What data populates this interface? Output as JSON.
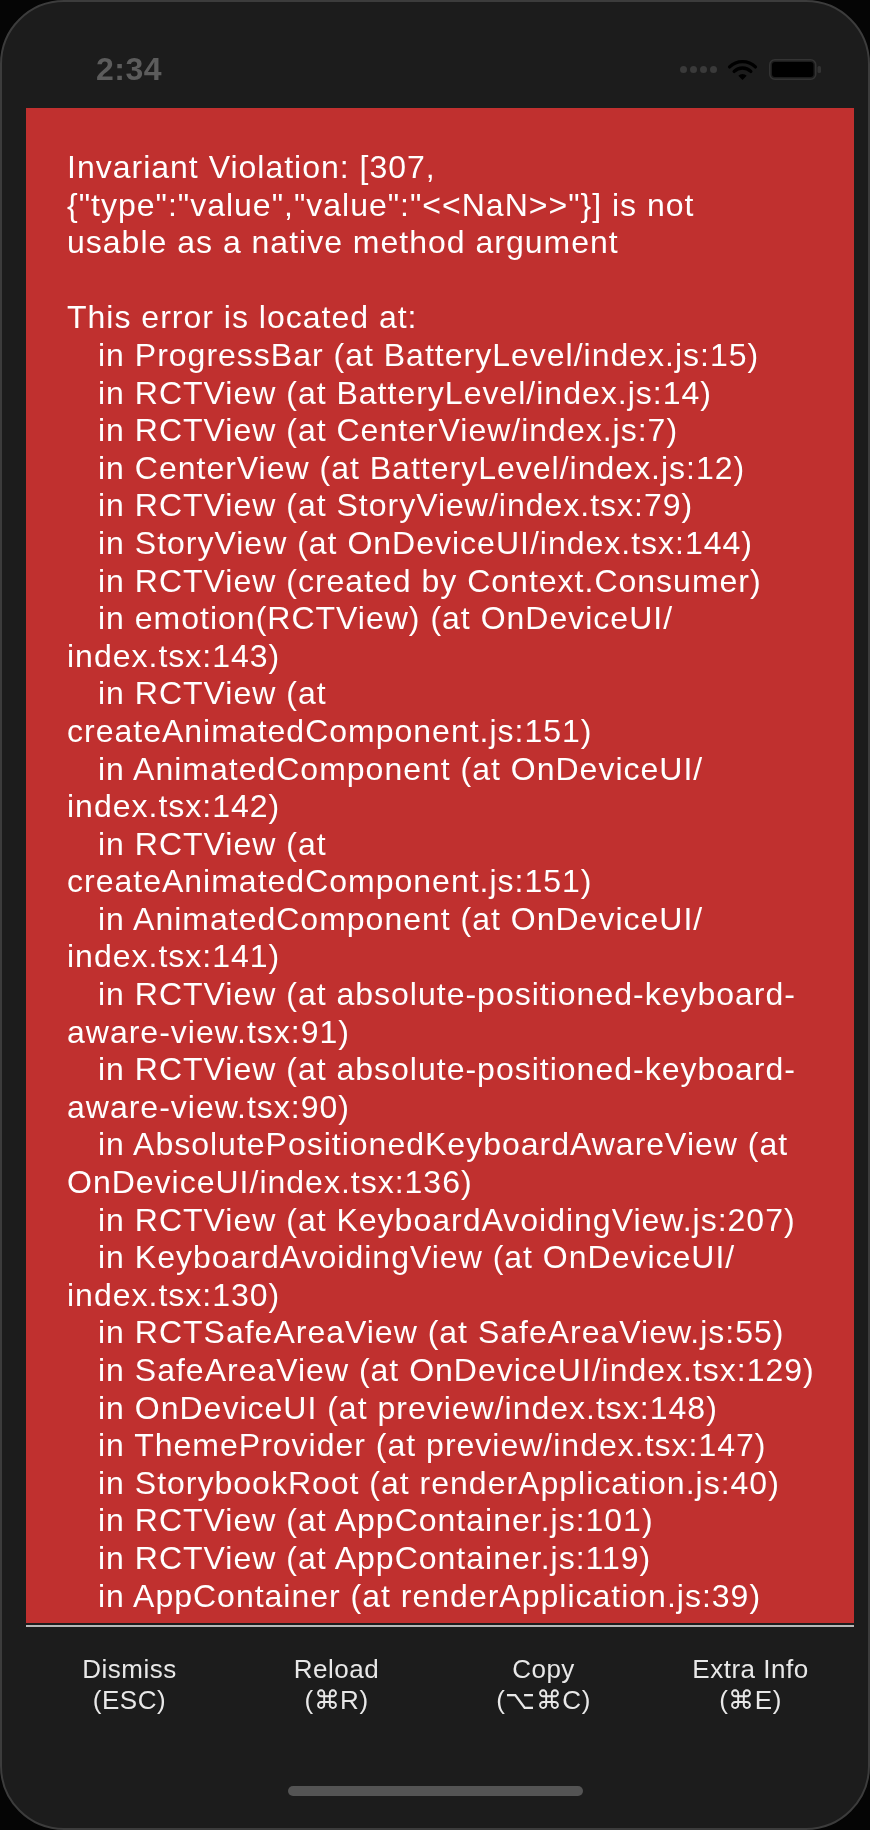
{
  "status_bar": {
    "time": "2:34"
  },
  "error": {
    "message_lines": [
      "Invariant Violation: [307,",
      "{\"type\":\"value\",\"value\":\"<<NaN>>\"}] is not",
      "usable as a native method argument"
    ],
    "location_heading": "This error is located at:",
    "stack": [
      {
        "lines": [
          "in ProgressBar (at BatteryLevel/index.js:15)"
        ]
      },
      {
        "lines": [
          "in RCTView (at BatteryLevel/index.js:14)"
        ]
      },
      {
        "lines": [
          "in RCTView (at CenterView/index.js:7)"
        ]
      },
      {
        "lines": [
          "in CenterView (at BatteryLevel/index.js:12)"
        ]
      },
      {
        "lines": [
          "in RCTView (at StoryView/index.tsx:79)"
        ]
      },
      {
        "lines": [
          "in StoryView (at OnDeviceUI/index.tsx:144)"
        ]
      },
      {
        "lines": [
          "in RCTView (created by Context.Consumer)"
        ]
      },
      {
        "lines": [
          "in emotion(RCTView) (at OnDeviceUI/",
          "index.tsx:143)"
        ]
      },
      {
        "lines": [
          "in RCTView (at",
          "createAnimatedComponent.js:151)"
        ]
      },
      {
        "lines": [
          "in AnimatedComponent (at OnDeviceUI/",
          "index.tsx:142)"
        ]
      },
      {
        "lines": [
          "in RCTView (at",
          "createAnimatedComponent.js:151)"
        ]
      },
      {
        "lines": [
          "in AnimatedComponent (at OnDeviceUI/",
          "index.tsx:141)"
        ]
      },
      {
        "lines": [
          "in RCTView (at absolute-positioned-keyboard-",
          "aware-view.tsx:91)"
        ]
      },
      {
        "lines": [
          "in RCTView (at absolute-positioned-keyboard-",
          "aware-view.tsx:90)"
        ]
      },
      {
        "lines": [
          "in AbsolutePositionedKeyboardAwareView (at",
          "OnDeviceUI/index.tsx:136)"
        ]
      },
      {
        "lines": [
          "in RCTView (at KeyboardAvoidingView.js:207)"
        ]
      },
      {
        "lines": [
          "in KeyboardAvoidingView (at OnDeviceUI/",
          "index.tsx:130)"
        ]
      },
      {
        "lines": [
          "in RCTSafeAreaView (at SafeAreaView.js:55)"
        ]
      },
      {
        "lines": [
          "in SafeAreaView (at OnDeviceUI/index.tsx:129)"
        ]
      },
      {
        "lines": [
          "in OnDeviceUI (at preview/index.tsx:148)"
        ]
      },
      {
        "lines": [
          "in ThemeProvider (at preview/index.tsx:147)"
        ]
      },
      {
        "lines": [
          "in StorybookRoot (at renderApplication.js:40)"
        ]
      },
      {
        "lines": [
          "in RCTView (at AppContainer.js:101)"
        ]
      },
      {
        "lines": [
          "in RCTView (at AppContainer.js:119)"
        ]
      },
      {
        "lines": [
          "in AppContainer (at renderApplication.js:39)"
        ]
      }
    ]
  },
  "actions": [
    {
      "label": "Dismiss",
      "shortcut": "(ESC)"
    },
    {
      "label": "Reload",
      "shortcut": "(⌘R)"
    },
    {
      "label": "Copy",
      "shortcut": "(⌥⌘C)"
    },
    {
      "label": "Extra Info",
      "shortcut": "(⌘E)"
    }
  ]
}
